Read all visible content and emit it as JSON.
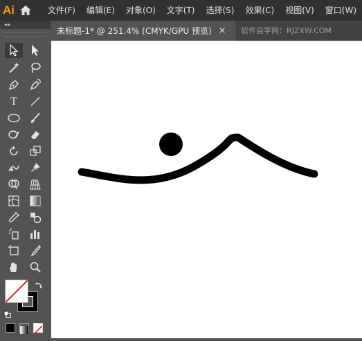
{
  "app": {
    "logo_text": "Ai"
  },
  "menu": {
    "items": [
      "文件(F)",
      "编辑(E)",
      "对象(O)",
      "文字(T)",
      "选择(S)",
      "效果(C)",
      "视图(V)",
      "窗口(W)"
    ]
  },
  "toolpanel": {
    "collapse_label": "◂◂",
    "type_tool_label": "T"
  },
  "tabs": {
    "active": {
      "title": "未标题-1* @ 251.4% (CMYK/GPU 预览)",
      "close_label": "×"
    },
    "inactive": {
      "title": "软件自学网：RJZXW.COM"
    }
  },
  "colors": {
    "accent": "#ff9a00",
    "menubar": "#323232",
    "panel": "#535353",
    "canvas": "#ffffff",
    "artwork": "#000000"
  }
}
